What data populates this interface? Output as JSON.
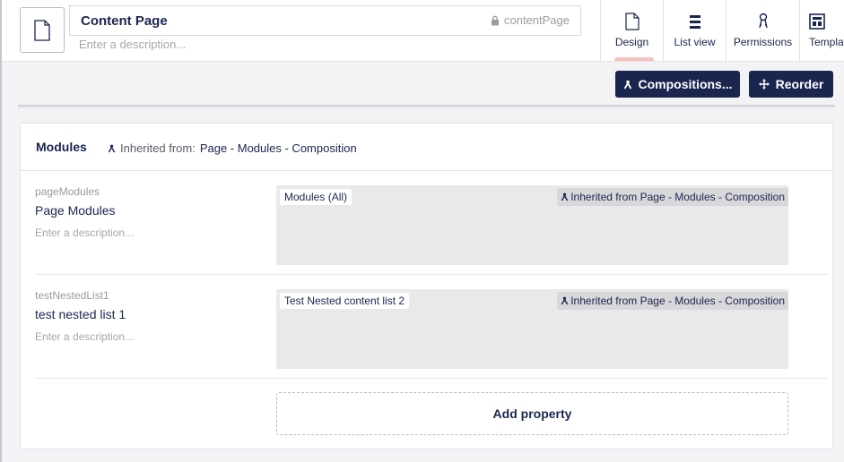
{
  "document_type": {
    "name": "Content Page",
    "alias": "contentPage",
    "description_placeholder": "Enter a description..."
  },
  "app_nav": [
    {
      "label": "Design",
      "icon": "document-icon",
      "active": true
    },
    {
      "label": "List view",
      "icon": "list-icon",
      "active": false
    },
    {
      "label": "Permissions",
      "icon": "keys-icon",
      "active": false
    },
    {
      "label": "Templat",
      "icon": "template-icon",
      "active": false
    }
  ],
  "toolbar": {
    "compositions_label": "Compositions...",
    "reorder_label": "Reorder"
  },
  "group": {
    "name": "Modules",
    "inherited_label": "Inherited from:",
    "inherited_source": "Page - Modules - Composition",
    "properties": [
      {
        "alias": "pageModules",
        "name": "Page Modules",
        "description_placeholder": "Enter a description...",
        "editor": "Modules (All)",
        "inherited_badge": "Inherited from Page - Modules - Composition"
      },
      {
        "alias": "testNestedList1",
        "name": "test nested list 1",
        "description_placeholder": "Enter a description...",
        "editor": "Test Nested content list 2",
        "inherited_badge": "Inherited from Page - Modules - Composition"
      }
    ],
    "add_property_label": "Add property"
  },
  "colors": {
    "primary": "#1b264f",
    "background": "#f3f2f5",
    "active_tab_indicator": "#f5c1bc",
    "editor_background": "#e9e9eb"
  }
}
